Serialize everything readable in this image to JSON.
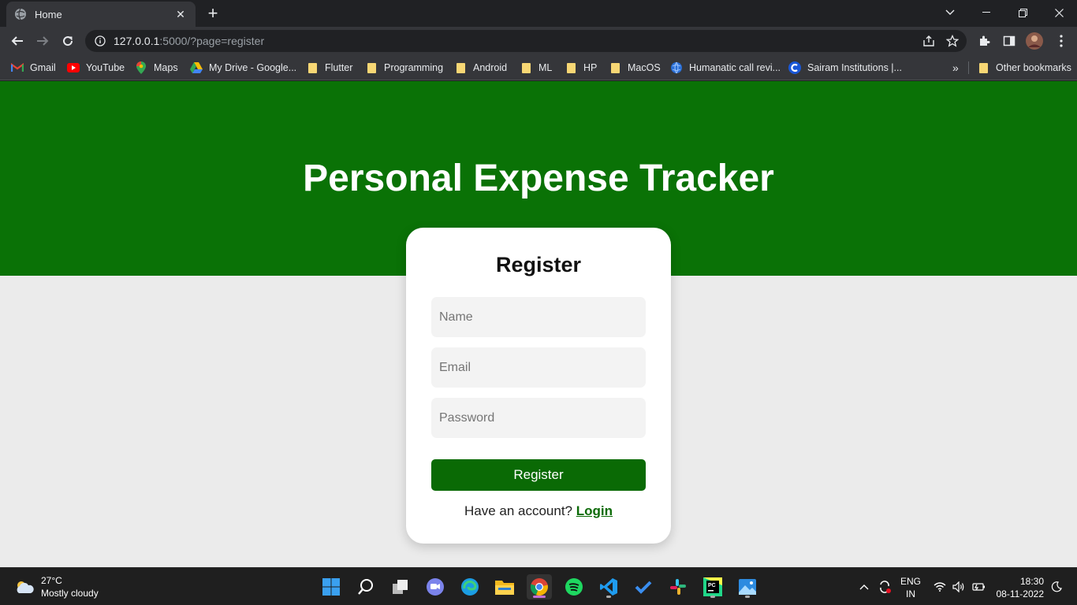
{
  "browser": {
    "tab_title": "Home",
    "url_host": "127.0.0.1",
    "url_path": ":5000/?page=register",
    "bookmarks": [
      {
        "label": "Gmail",
        "icon": "gmail-icon"
      },
      {
        "label": "YouTube",
        "icon": "youtube-icon"
      },
      {
        "label": "Maps",
        "icon": "maps-icon"
      },
      {
        "label": "My Drive - Google...",
        "icon": "google-drive-icon"
      },
      {
        "label": "Flutter",
        "icon": "folder-icon"
      },
      {
        "label": "Programming",
        "icon": "folder-icon"
      },
      {
        "label": "Android",
        "icon": "folder-icon"
      },
      {
        "label": "ML",
        "icon": "folder-icon"
      },
      {
        "label": "HP",
        "icon": "folder-icon"
      },
      {
        "label": "MacOS",
        "icon": "folder-icon"
      },
      {
        "label": "Humanatic call revi...",
        "icon": "globe-icon"
      },
      {
        "label": "Sairam Institutions |...",
        "icon": "sairam-icon"
      }
    ],
    "more_bookmarks": "»",
    "other_bookmarks": "Other bookmarks"
  },
  "page": {
    "heading": "Personal Expense Tracker",
    "form": {
      "title": "Register",
      "name_placeholder": "Name",
      "email_placeholder": "Email",
      "password_placeholder": "Password",
      "submit_label": "Register",
      "alt_text": "Have an account?",
      "alt_link": "Login"
    }
  },
  "taskbar": {
    "weather_temp": "27°C",
    "weather_desc": "Mostly cloudy",
    "lang_top": "ENG",
    "lang_bottom": "IN",
    "time": "18:30",
    "date": "08-11-2022"
  },
  "colors": {
    "brand_green": "#0a7206",
    "page_bg": "#ebebeb"
  }
}
